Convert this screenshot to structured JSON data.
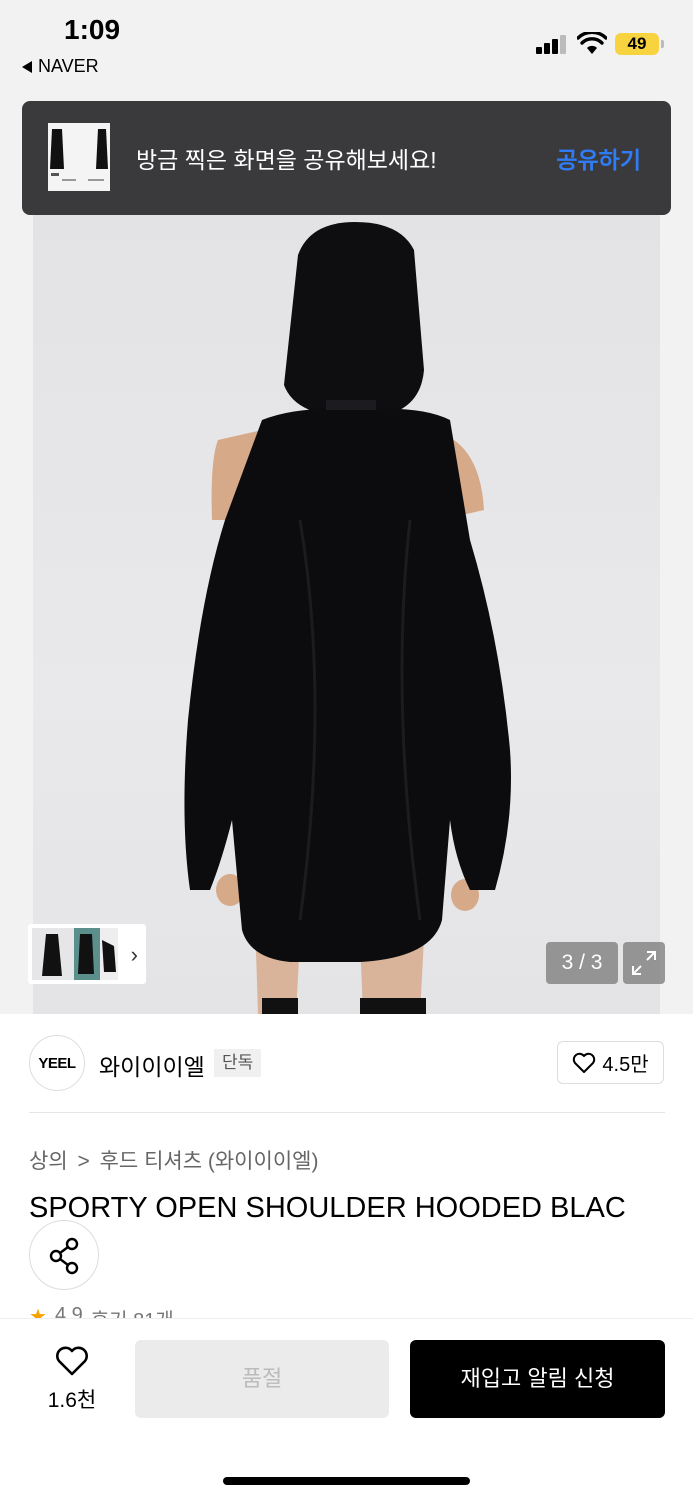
{
  "status_bar": {
    "time": "1:09",
    "back_app": "NAVER",
    "battery": "49"
  },
  "share_banner": {
    "message": "방금 찍은 화면을 공유해보세요!",
    "action": "공유하기"
  },
  "gallery": {
    "counter": "3 / 3"
  },
  "brand": {
    "logo": "YEEL",
    "name": "와이이이엘",
    "tag": "단독",
    "likes": "4.5만"
  },
  "breadcrumb": {
    "category": "상의",
    "separator": ">",
    "subcategory": "후드 티셔츠 (와이이이엘)"
  },
  "product": {
    "title": "SPORTY OPEN SHOULDER HOODED BLAC"
  },
  "rating": {
    "score": "4.9",
    "reviews": "후기 81개"
  },
  "bottom_bar": {
    "wish_count": "1.6천",
    "soldout_label": "품절",
    "restock_label": "재입고 알림 신청"
  },
  "colors": {
    "accent": "#2f7cf6",
    "banner_bg": "#3a3a3c",
    "battery": "#f6d33f",
    "star": "#f5a300"
  }
}
